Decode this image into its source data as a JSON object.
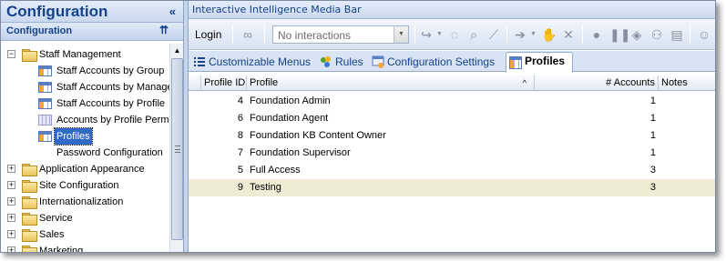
{
  "left_panel": {
    "title": "Configuration",
    "collapse_glyph": "«",
    "section_title": "Configuration",
    "section_collapse_glyph": "⇈",
    "tree": [
      {
        "label": "Staff Management",
        "expander": "−",
        "icon": "folder-icon"
      },
      {
        "label": "Staff Accounts by Group",
        "icon": "report-grid-icon"
      },
      {
        "label": "Staff Accounts by Manager",
        "icon": "report-grid-icon"
      },
      {
        "label": "Staff Accounts by Profile",
        "icon": "report-grid-icon"
      },
      {
        "label": "Accounts by Profile Permissions",
        "icon": "report-lavender-icon"
      },
      {
        "label": "Profiles",
        "icon": "report-grid-icon",
        "selected": true
      },
      {
        "label": "Password Configuration",
        "icon": "none"
      },
      {
        "label": "Application Appearance",
        "expander": "+",
        "icon": "folder-icon"
      },
      {
        "label": "Site Configuration",
        "expander": "+",
        "icon": "folder-icon"
      },
      {
        "label": "Internationalization",
        "expander": "+",
        "icon": "folder-icon"
      },
      {
        "label": "Service",
        "expander": "+",
        "icon": "folder-icon"
      },
      {
        "label": "Sales",
        "expander": "+",
        "icon": "folder-icon"
      },
      {
        "label": "Marketing",
        "expander": "+",
        "icon": "folder-icon"
      }
    ]
  },
  "media_bar": {
    "title": "Interactive Intelligence Media Bar",
    "login_label": "Login",
    "interactions_value": "No interactions"
  },
  "tabs": [
    {
      "label": "Customizable Menus",
      "icon": "menu-icon"
    },
    {
      "label": "Rules",
      "icon": "rules-icon"
    },
    {
      "label": "Configuration Settings",
      "icon": "settings-icon"
    },
    {
      "label": "Profiles",
      "icon": "report-grid-icon",
      "active": true
    }
  ],
  "grid": {
    "columns": [
      "Profile ID",
      "Profile",
      "# Accounts",
      "Notes"
    ],
    "sort_glyph": "^",
    "rows": [
      {
        "id": "4",
        "profile": "Foundation Admin",
        "accounts": "1",
        "notes": ""
      },
      {
        "id": "6",
        "profile": "Foundation Agent",
        "accounts": "1",
        "notes": ""
      },
      {
        "id": "8",
        "profile": "Foundation KB Content Owner",
        "accounts": "1",
        "notes": ""
      },
      {
        "id": "7",
        "profile": "Foundation Supervisor",
        "accounts": "1",
        "notes": ""
      },
      {
        "id": "5",
        "profile": "Full Access",
        "accounts": "3",
        "notes": ""
      },
      {
        "id": "9",
        "profile": "Testing",
        "accounts": "3",
        "notes": "",
        "highlighted": true
      }
    ]
  },
  "colors": {
    "header_text": "#15428b",
    "selection": "#3169c6",
    "row_highlight": "#eeecd4"
  }
}
